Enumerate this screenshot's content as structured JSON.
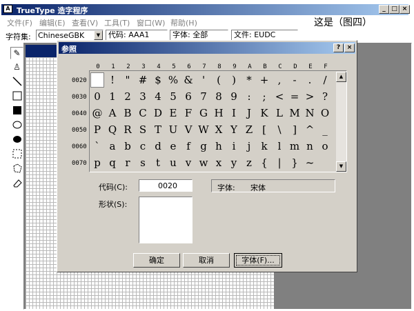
{
  "app": {
    "title": "TrueType 造字程序",
    "caption_right": "这是（图四）"
  },
  "menu": {
    "items": [
      "文件(F)",
      "编辑(E)",
      "查看(V)",
      "工具(T)",
      "窗口(W)",
      "帮助(H)"
    ]
  },
  "toolbar": {
    "charset_label": "字符集:",
    "charset_value": "ChineseGBK",
    "code": "代码: AAA1",
    "font": "字体: 全部",
    "file": "文件: EUDC"
  },
  "tools": [
    "pencil-icon",
    "brush-icon",
    "line-icon",
    "hollow-rect-icon",
    "filled-rect-icon",
    "hollow-ellipse-icon",
    "filled-ellipse-icon",
    "rect-select-icon",
    "freeform-select-icon",
    "eraser-icon"
  ],
  "dialog": {
    "title": "参照",
    "help": "?",
    "close": "×",
    "columns": [
      "0",
      "1",
      "2",
      "3",
      "4",
      "5",
      "6",
      "7",
      "8",
      "9",
      "A",
      "B",
      "C",
      "D",
      "E",
      "F"
    ],
    "rows": [
      {
        "label": "0020",
        "chars": [
          "",
          "!",
          "\"",
          "#",
          "$",
          "%",
          "&",
          "'",
          "(",
          ")",
          "*",
          "+",
          ",",
          "-",
          ".",
          "/"
        ]
      },
      {
        "label": "0030",
        "chars": [
          "0",
          "1",
          "2",
          "3",
          "4",
          "5",
          "6",
          "7",
          "8",
          "9",
          ":",
          ";",
          "<",
          "=",
          ">",
          "?"
        ]
      },
      {
        "label": "0040",
        "chars": [
          "@",
          "A",
          "B",
          "C",
          "D",
          "E",
          "F",
          "G",
          "H",
          "I",
          "J",
          "K",
          "L",
          "M",
          "N",
          "O"
        ]
      },
      {
        "label": "0050",
        "chars": [
          "P",
          "Q",
          "R",
          "S",
          "T",
          "U",
          "V",
          "W",
          "X",
          "Y",
          "Z",
          "[",
          "\\",
          "]",
          "^",
          "_"
        ]
      },
      {
        "label": "0060",
        "chars": [
          "`",
          "a",
          "b",
          "c",
          "d",
          "e",
          "f",
          "g",
          "h",
          "i",
          "j",
          "k",
          "l",
          "m",
          "n",
          "o"
        ]
      },
      {
        "label": "0070",
        "chars": [
          "p",
          "q",
          "r",
          "s",
          "t",
          "u",
          "v",
          "w",
          "x",
          "y",
          "z",
          "{",
          "|",
          "}",
          "~",
          ""
        ]
      }
    ],
    "code_label": "代码(C):",
    "code_value": "0020",
    "font_label": "字体:",
    "font_value": "宋体",
    "shape_label": "形状(S):",
    "ok": "确定",
    "cancel": "取消",
    "font_button": "字体(F)..."
  }
}
